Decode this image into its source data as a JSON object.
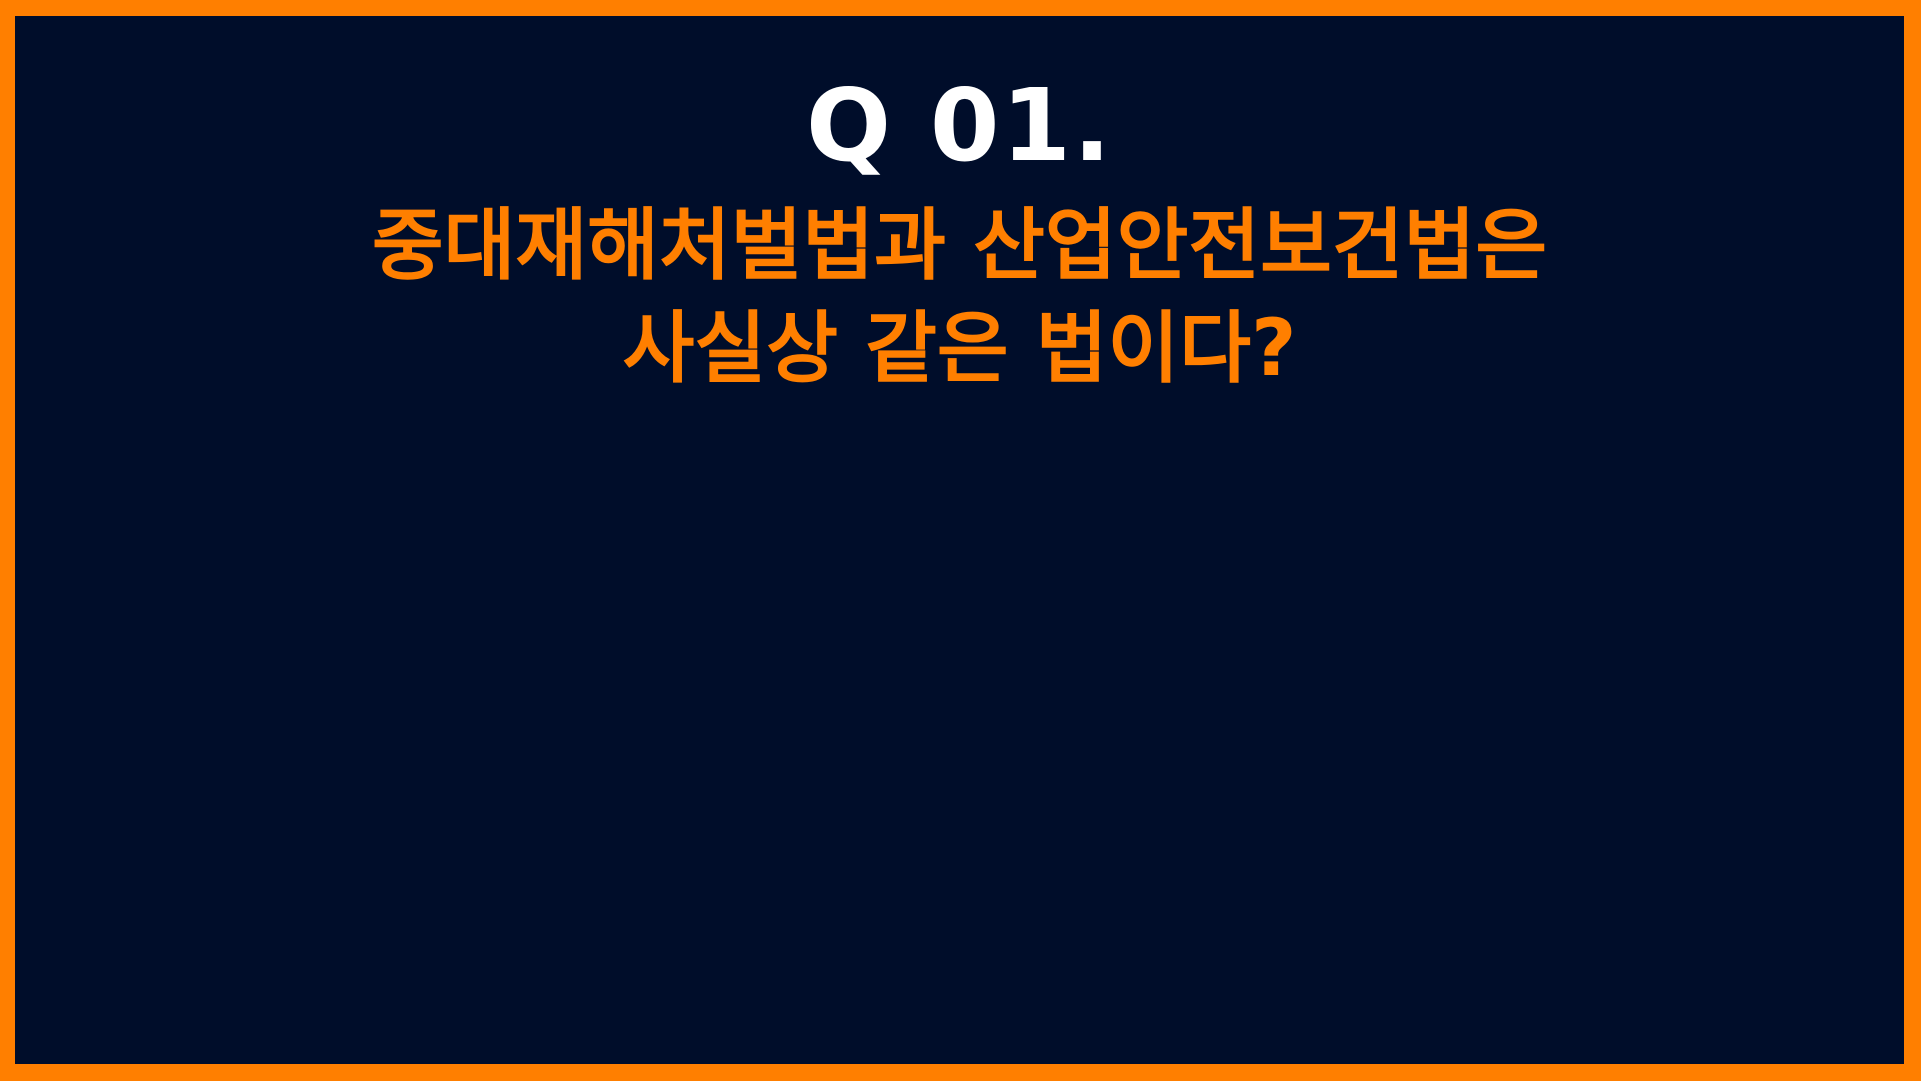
{
  "slide": {
    "question_number": "Q 01.",
    "question_lines": [
      "중대재해처벌법과 산업안전보건법은",
      "사실상 같은 법이다?"
    ],
    "colors": {
      "accent": "#ff7f00",
      "background": "#000d2a",
      "title": "#ffffff"
    }
  }
}
